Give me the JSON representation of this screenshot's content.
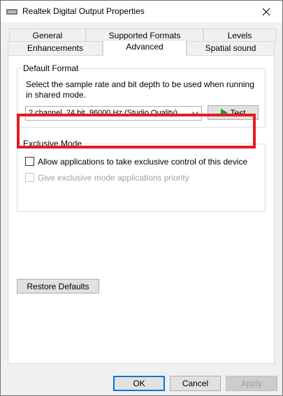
{
  "window": {
    "title": "Realtek Digital Output Properties",
    "close_icon": "close-icon"
  },
  "tabs": [
    {
      "label": "General",
      "active": false
    },
    {
      "label": "Supported Formats",
      "active": false
    },
    {
      "label": "Levels",
      "active": false
    },
    {
      "label": "Enhancements",
      "active": false
    },
    {
      "label": "Advanced",
      "active": true
    },
    {
      "label": "Spatial sound",
      "active": false
    }
  ],
  "default_format": {
    "legend": "Default Format",
    "description": "Select the sample rate and bit depth to be used when running in shared mode.",
    "selected_format": "2 channel, 24 bit, 96000 Hz (Studio Quality)",
    "test_label": "Test"
  },
  "exclusive_mode": {
    "legend": "Exclusive Mode",
    "allow_label": "Allow applications to take exclusive control of this device",
    "allow_checked": false,
    "priority_label": "Give exclusive mode applications priority",
    "priority_checked": false,
    "priority_enabled": false
  },
  "restore_label": "Restore Defaults",
  "footer": {
    "ok_label": "OK",
    "cancel_label": "Cancel",
    "apply_label": "Apply"
  },
  "colors": {
    "highlight": "#e31c23",
    "play_icon": "#1f9d1f",
    "default_button_border": "#0078d7"
  }
}
